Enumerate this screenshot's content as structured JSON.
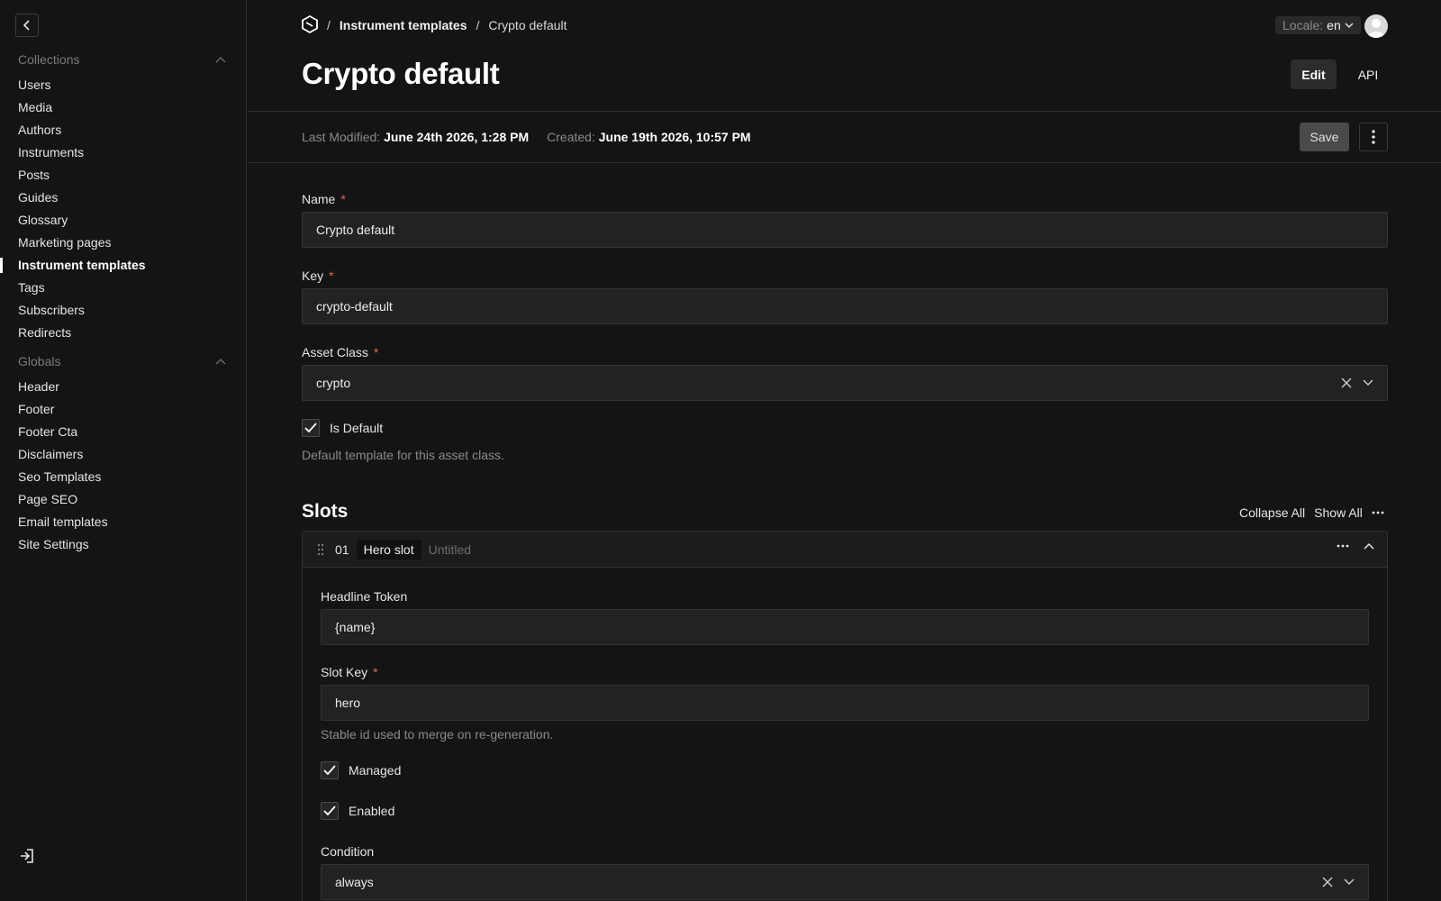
{
  "sidebar": {
    "collections_label": "Collections",
    "collections": [
      {
        "label": "Users"
      },
      {
        "label": "Media"
      },
      {
        "label": "Authors"
      },
      {
        "label": "Instruments"
      },
      {
        "label": "Posts"
      },
      {
        "label": "Guides"
      },
      {
        "label": "Glossary"
      },
      {
        "label": "Marketing pages"
      },
      {
        "label": "Instrument templates",
        "active": true
      },
      {
        "label": "Tags"
      },
      {
        "label": "Subscribers"
      },
      {
        "label": "Redirects"
      }
    ],
    "globals_label": "Globals",
    "globals": [
      {
        "label": "Header"
      },
      {
        "label": "Footer"
      },
      {
        "label": "Footer Cta"
      },
      {
        "label": "Disclaimers"
      },
      {
        "label": "Seo Templates"
      },
      {
        "label": "Page SEO"
      },
      {
        "label": "Email templates"
      },
      {
        "label": "Site Settings"
      }
    ]
  },
  "header": {
    "breadcrumb_sep": "/",
    "breadcrumb_link": "Instrument templates",
    "breadcrumb_current": "Crypto default",
    "locale_label": "Locale:",
    "locale_value": "en",
    "title": "Crypto default",
    "edit_label": "Edit",
    "api_label": "API"
  },
  "meta": {
    "modified_label": "Last Modified:",
    "modified_value": "June 24th 2026, 1:28 PM",
    "created_label": "Created:",
    "created_value": "June 19th 2026, 10:57 PM",
    "save_label": "Save"
  },
  "form": {
    "name_label": "Name",
    "name_value": "Crypto default",
    "key_label": "Key",
    "key_value": "crypto-default",
    "asset_class_label": "Asset Class",
    "asset_class_value": "crypto",
    "is_default_label": "Is Default",
    "is_default_help": "Default template for this asset class.",
    "required_mark": "*"
  },
  "slots": {
    "title": "Slots",
    "collapse_all": "Collapse All",
    "show_all": "Show All",
    "items": [
      {
        "number": "01",
        "type": "Hero slot",
        "name": "Untitled",
        "headline_token_label": "Headline Token",
        "headline_token_value": "{name}",
        "slot_key_label": "Slot Key",
        "slot_key_value": "hero",
        "slot_key_help": "Stable id used to merge on re-generation.",
        "managed_label": "Managed",
        "enabled_label": "Enabled",
        "condition_label": "Condition",
        "condition_value": "always"
      }
    ]
  }
}
